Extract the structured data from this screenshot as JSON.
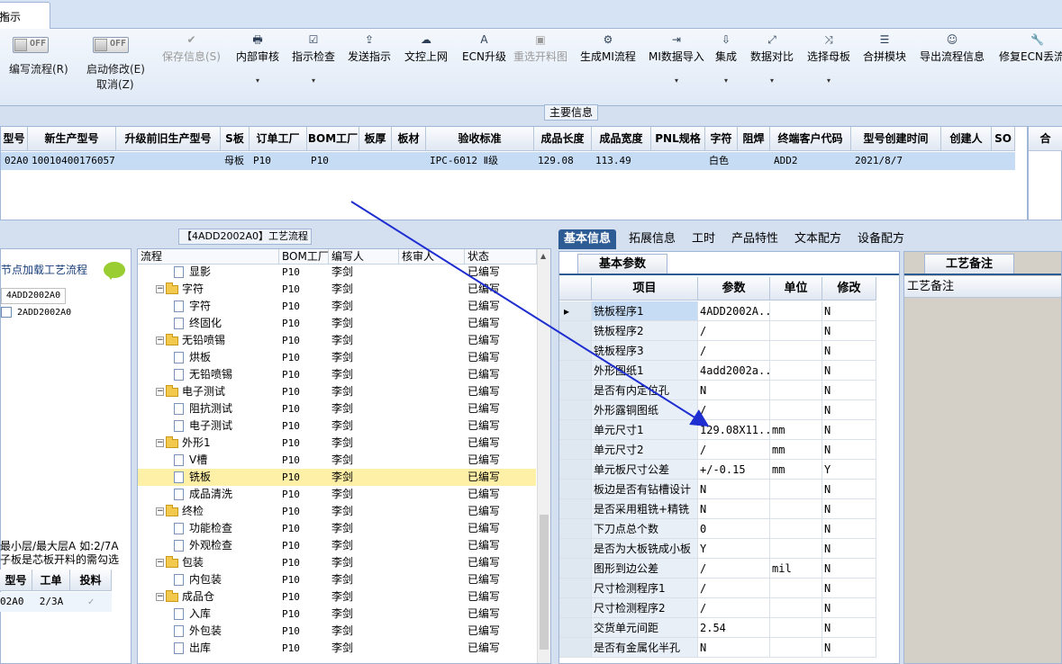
{
  "tab": {
    "title": "指示",
    "close": "×"
  },
  "ribbon": {
    "edit_flow": {
      "toggle": "OFF",
      "label": "编写流程(R)"
    },
    "start_modify": {
      "toggle": "OFF",
      "label": "启动修改(E)",
      "label2": "取消(Z)"
    },
    "buttons": [
      {
        "label": "保存信息(S)",
        "icon": "✔"
      },
      {
        "label": "内部审核",
        "icon": "🖶"
      },
      {
        "label": "指示检查",
        "icon": "☑"
      },
      {
        "label": "发送指示",
        "icon": "⇪"
      },
      {
        "label": "文控上网",
        "icon": "☁"
      },
      {
        "label": "ECN升级",
        "icon": "A"
      },
      {
        "label": "重选开料图",
        "icon": "▣"
      },
      {
        "label": "生成MI流程",
        "icon": "⚙"
      },
      {
        "label": "MI数据导入",
        "icon": "⇥"
      },
      {
        "label": "集成",
        "icon": "⇩"
      },
      {
        "label": "数据对比",
        "icon": "⤢"
      },
      {
        "label": "选择母板",
        "icon": "⤨"
      },
      {
        "label": "合拼模块",
        "icon": "☰"
      },
      {
        "label": "导出流程信息",
        "icon": "☺"
      },
      {
        "label": "修复ECN丢流程",
        "icon": "🔧"
      }
    ],
    "dropdown": "▾"
  },
  "main_info": {
    "caption": "主要信息",
    "headers": [
      "型号",
      "新生产型号",
      "升级前旧生产型号",
      "S板",
      "订单工厂",
      "BOM工厂",
      "板厚",
      "板材",
      "验收标准",
      "成品长度",
      "成品宽度",
      "PNL规格",
      "字符",
      "阻焊",
      "终端客户代码",
      "型号创建时间",
      "创建人",
      "SO"
    ],
    "row": [
      "02A0",
      "10010400176057",
      "",
      "母板",
      "P10",
      "P10",
      "",
      "",
      "IPC-6012 Ⅱ级",
      "129.08",
      "113.49",
      "",
      "白色",
      "",
      "ADD2",
      "2021/8/7",
      "",
      ""
    ],
    "extra_header": "合"
  },
  "left_panel": {
    "caption": "节点加载工艺流程",
    "tab": "4ADD2002A0",
    "item": "2ADD2002A0",
    "note1": "最小层/最大层A 如:2/7A",
    "note2": "子板是芯板开料的需勾选",
    "grid_headers": [
      "型号",
      "工单",
      "投料"
    ],
    "grid_row": [
      "02A0",
      "2/3A",
      "✓"
    ]
  },
  "process": {
    "caption": "【4ADD2002A0】工艺流程",
    "headers": [
      "流程",
      "BOM工厂",
      "编写人",
      "核审人",
      "状态"
    ],
    "rows": [
      {
        "name": "显影",
        "type": "doc",
        "level": 2,
        "factory": "P10",
        "writer": "李剑",
        "status": "已编写"
      },
      {
        "name": "字符",
        "type": "folder",
        "level": 1,
        "factory": "P10",
        "writer": "李剑",
        "status": "已编写"
      },
      {
        "name": "字符",
        "type": "doc",
        "level": 2,
        "factory": "P10",
        "writer": "李剑",
        "status": "已编写"
      },
      {
        "name": "终固化",
        "type": "doc",
        "level": 2,
        "factory": "P10",
        "writer": "李剑",
        "status": "已编写"
      },
      {
        "name": "无铅喷锡",
        "type": "folder",
        "level": 1,
        "factory": "P10",
        "writer": "李剑",
        "status": "已编写"
      },
      {
        "name": "烘板",
        "type": "doc",
        "level": 2,
        "factory": "P10",
        "writer": "李剑",
        "status": "已编写"
      },
      {
        "name": "无铅喷锡",
        "type": "doc",
        "level": 2,
        "factory": "P10",
        "writer": "李剑",
        "status": "已编写"
      },
      {
        "name": "电子测试",
        "type": "folder",
        "level": 1,
        "factory": "P10",
        "writer": "李剑",
        "status": "已编写"
      },
      {
        "name": "阻抗测试",
        "type": "doc",
        "level": 2,
        "factory": "P10",
        "writer": "李剑",
        "status": "已编写"
      },
      {
        "name": "电子测试",
        "type": "doc",
        "level": 2,
        "factory": "P10",
        "writer": "李剑",
        "status": "已编写"
      },
      {
        "name": "外形1",
        "type": "folder",
        "level": 1,
        "factory": "P10",
        "writer": "李剑",
        "status": "已编写"
      },
      {
        "name": "V槽",
        "type": "doc",
        "level": 2,
        "factory": "P10",
        "writer": "李剑",
        "status": "已编写"
      },
      {
        "name": "铣板",
        "type": "doc",
        "level": 2,
        "factory": "P10",
        "writer": "李剑",
        "status": "已编写",
        "selected": true
      },
      {
        "name": "成品清洗",
        "type": "doc",
        "level": 2,
        "factory": "P10",
        "writer": "李剑",
        "status": "已编写"
      },
      {
        "name": "终检",
        "type": "folder",
        "level": 1,
        "factory": "P10",
        "writer": "李剑",
        "status": "已编写"
      },
      {
        "name": "功能检查",
        "type": "doc",
        "level": 2,
        "factory": "P10",
        "writer": "李剑",
        "status": "已编写"
      },
      {
        "name": "外观检查",
        "type": "doc",
        "level": 2,
        "factory": "P10",
        "writer": "李剑",
        "status": "已编写"
      },
      {
        "name": "包装",
        "type": "folder",
        "level": 1,
        "factory": "P10",
        "writer": "李剑",
        "status": "已编写"
      },
      {
        "name": "内包装",
        "type": "doc",
        "level": 2,
        "factory": "P10",
        "writer": "李剑",
        "status": "已编写"
      },
      {
        "name": "成品仓",
        "type": "folder",
        "level": 1,
        "factory": "P10",
        "writer": "李剑",
        "status": "已编写"
      },
      {
        "name": "入库",
        "type": "doc",
        "level": 2,
        "factory": "P10",
        "writer": "李剑",
        "status": "已编写"
      },
      {
        "name": "外包装",
        "type": "doc",
        "level": 2,
        "factory": "P10",
        "writer": "李剑",
        "status": "已编写"
      },
      {
        "name": "出库",
        "type": "doc",
        "level": 2,
        "factory": "P10",
        "writer": "李剑",
        "status": "已编写"
      }
    ]
  },
  "detail": {
    "tabs": [
      "基本信息",
      "拓展信息",
      "工时",
      "产品特性",
      "文本配方",
      "设备配方"
    ],
    "basic_tab": "基本参数",
    "headers": [
      "项目",
      "参数",
      "单位",
      "修改"
    ],
    "rows": [
      {
        "item": "铣板程序1",
        "param": "4ADD2002A...",
        "unit": "",
        "mod": "N",
        "current": true
      },
      {
        "item": "铣板程序2",
        "param": "/",
        "unit": "",
        "mod": "N"
      },
      {
        "item": "铣板程序3",
        "param": "/",
        "unit": "",
        "mod": "N"
      },
      {
        "item": "外形图纸1",
        "param": "4add2002a...",
        "unit": "",
        "mod": "N"
      },
      {
        "item": "是否有内定位孔",
        "param": "N",
        "unit": "",
        "mod": "N"
      },
      {
        "item": "外形露铜图纸",
        "param": "/",
        "unit": "",
        "mod": "N"
      },
      {
        "item": "单元尺寸1",
        "param": "129.08X11...",
        "unit": "mm",
        "mod": "N"
      },
      {
        "item": "单元尺寸2",
        "param": "/",
        "unit": "mm",
        "mod": "N"
      },
      {
        "item": "单元板尺寸公差",
        "param": "+/-0.15",
        "unit": "mm",
        "mod": "Y"
      },
      {
        "item": "板边是否有钻槽设计",
        "param": "N",
        "unit": "",
        "mod": "N"
      },
      {
        "item": "是否采用粗铣+精铣",
        "param": "N",
        "unit": "",
        "mod": "N"
      },
      {
        "item": "下刀点总个数",
        "param": "0",
        "unit": "",
        "mod": "N"
      },
      {
        "item": "是否为大板铣成小板",
        "param": "Y",
        "unit": "",
        "mod": "N"
      },
      {
        "item": "图形到边公差",
        "param": "/",
        "unit": "mil",
        "mod": "N"
      },
      {
        "item": "尺寸检测程序1",
        "param": "/",
        "unit": "",
        "mod": "N"
      },
      {
        "item": "尺寸检测程序2",
        "param": "/",
        "unit": "",
        "mod": "N"
      },
      {
        "item": "交货单元间距",
        "param": "2.54",
        "unit": "",
        "mod": "N"
      },
      {
        "item": "是否有金属化半孔",
        "param": "N",
        "unit": "",
        "mod": "N"
      }
    ],
    "row_pointer": "▸"
  },
  "notes": {
    "tab": "工艺备注",
    "label": "工艺备注"
  },
  "colors": {
    "accent": "#2d5b94",
    "selected_row": "#c6dcf5",
    "highlight": "#fff0a8",
    "arrow": "#1f2ed1"
  }
}
